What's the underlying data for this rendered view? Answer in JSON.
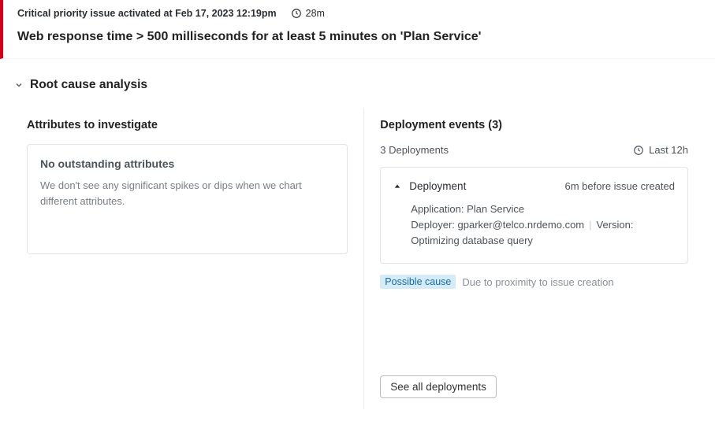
{
  "alert": {
    "status_line": "Critical priority issue activated at Feb 17, 2023 12:19pm",
    "duration": "28m",
    "title": "Web response time > 500 milliseconds for at least 5 minutes on 'Plan Service'"
  },
  "section": {
    "title": "Root cause analysis"
  },
  "attributes": {
    "heading": "Attributes to investigate",
    "empty_title": "No outstanding attributes",
    "empty_body": "We don't see any significant spikes or dips when we chart different attributes."
  },
  "deployments": {
    "heading": "Deployment events (3)",
    "count_label": "3 Deployments",
    "range_label": "Last 12h",
    "card": {
      "type": "Deployment",
      "time_relative": "6m before issue created",
      "app_line": "Application: Plan Service",
      "deployer_line": "Deployer: gparker@telco.nrdemo.com",
      "version_line": "Version:",
      "desc": "Optimizing database query"
    },
    "tag": "Possible cause",
    "tag_desc": "Due to proximity to issue creation",
    "see_all": "See all deployments"
  }
}
